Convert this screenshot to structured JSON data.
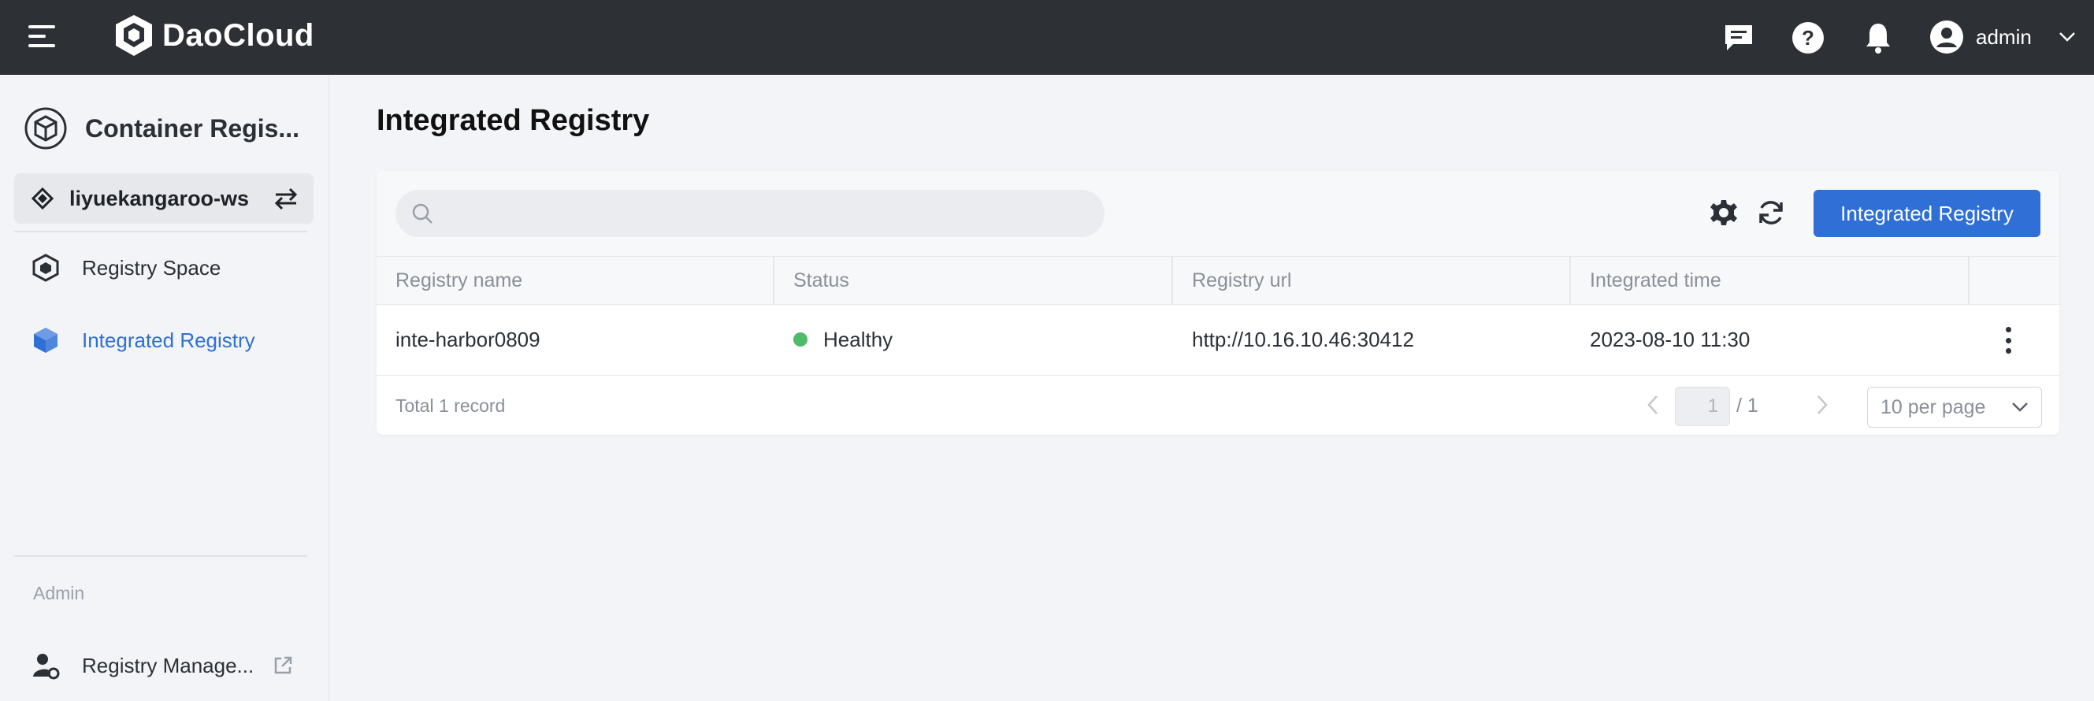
{
  "topbar": {
    "brand": "DaoCloud",
    "user": "admin",
    "icons": [
      "menu-icon",
      "message-icon",
      "help-icon",
      "bell-icon",
      "user-avatar-icon",
      "chevron-down-icon"
    ]
  },
  "sidebar": {
    "app_title": "Container Regis...",
    "workspace": "liyuekangaroo-ws",
    "items": [
      {
        "label": "Registry Space",
        "icon": "cube-outline-icon",
        "active": false
      },
      {
        "label": "Integrated Registry",
        "icon": "cube-filled-icon",
        "active": true
      }
    ],
    "section_label": "Admin",
    "admin_items": [
      {
        "label": "Registry Manage...",
        "icon": "user-gear-icon"
      }
    ]
  },
  "main": {
    "page_title": "Integrated Registry",
    "search": {
      "placeholder": "",
      "value": ""
    },
    "primary_button": "Integrated Registry",
    "table": {
      "columns": [
        "Registry name",
        "Status",
        "Registry url",
        "Integrated time"
      ],
      "rows": [
        {
          "name": "inte-harbor0809",
          "status": "Healthy",
          "url": "http://10.16.10.46:30412",
          "time": "2023-08-10 11:30"
        }
      ]
    },
    "footer": {
      "total": "Total 1 record",
      "page": "1",
      "page_total": "/ 1",
      "per_page": "10 per page"
    }
  },
  "colors": {
    "topbar": "#2d3035",
    "accent": "#2f6fd6",
    "healthy": "#4dbd6a"
  }
}
